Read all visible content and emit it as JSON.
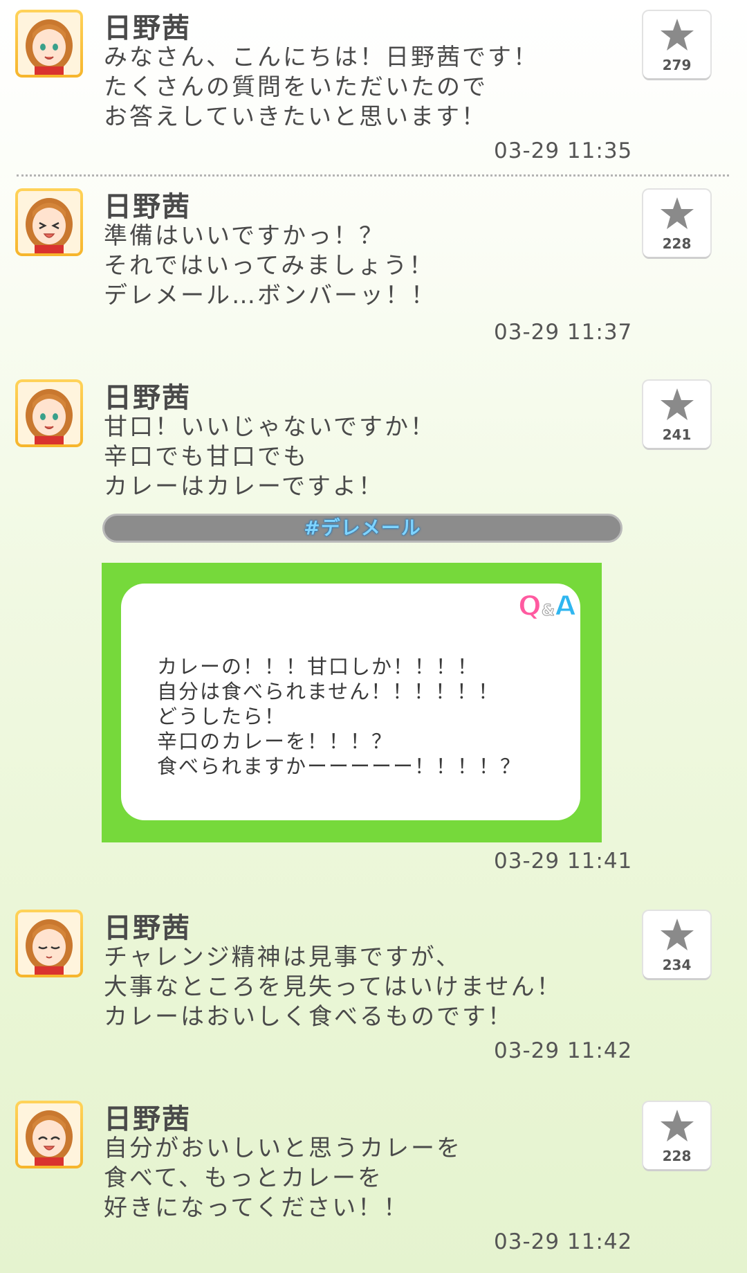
{
  "posts": [
    {
      "author": "日野茜",
      "lines": [
        "みなさん、こんにちは！日野茜です！",
        "たくさんの質問をいただいたので",
        "お答えしていきたいと思います！"
      ],
      "time": "03-29 11:35",
      "stars": "279",
      "expression": "smile"
    },
    {
      "author": "日野茜",
      "lines": [
        "準備はいいですかっ！？",
        "それではいってみましょう！",
        "デレメール…ボンバーッ！！"
      ],
      "time": "03-29 11:37",
      "stars": "228",
      "expression": "squint"
    },
    {
      "author": "日野茜",
      "lines": [
        "甘口！いいじゃないですか！",
        "辛口でも甘口でも",
        "カレーはカレーですよ！"
      ],
      "time": "03-29 11:41",
      "stars": "241",
      "expression": "smile",
      "hashtag": "#デレメール",
      "qa": {
        "badge_q": "Q",
        "badge_amp": "&",
        "badge_a": "A",
        "lines": [
          "カレーの！！！甘口しか！！！！",
          "自分は食べられません！！！！！！",
          "どうしたら！",
          "辛口のカレーを！！！？",
          "食べられますかーーーーー！！！！？"
        ]
      }
    },
    {
      "author": "日野茜",
      "lines": [
        "チャレンジ精神は見事ですが、",
        "大事なところを見失ってはいけません！",
        "カレーはおいしく食べるものです！"
      ],
      "time": "03-29 11:42",
      "stars": "234",
      "expression": "closed"
    },
    {
      "author": "日野茜",
      "lines": [
        "自分がおいしいと思うカレーを",
        "食べて、もっとカレーを",
        "好きになってください！！"
      ],
      "time": "03-29 11:42",
      "stars": "228",
      "expression": "happy"
    }
  ],
  "icons": {
    "star": "star-icon",
    "avatar": "avatar-image"
  },
  "colors": {
    "qa_green": "#76d93b",
    "hashtag_bar": "#8c8c8c",
    "hashtag_text": "#7fd4ff",
    "star_gray": "#8a8a8a"
  }
}
